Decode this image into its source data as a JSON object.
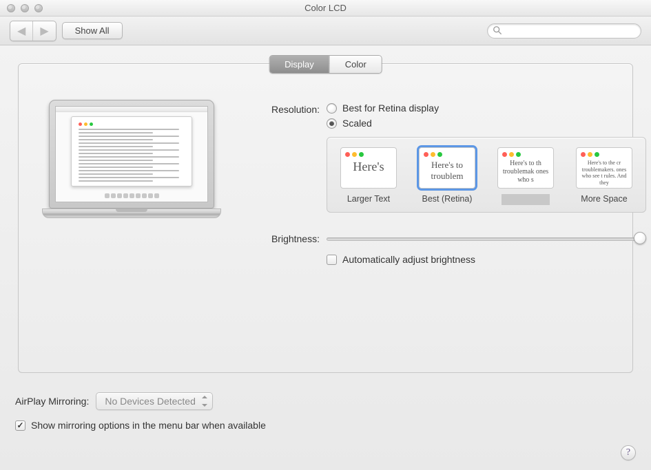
{
  "window": {
    "title": "Color LCD"
  },
  "toolbar": {
    "back_icon": "◀",
    "forward_icon": "▶",
    "show_all_label": "Show All",
    "search_placeholder": ""
  },
  "tabs": {
    "display": "Display",
    "color": "Color",
    "active": "display"
  },
  "resolution": {
    "label": "Resolution:",
    "option_best": "Best for Retina display",
    "option_scaled": "Scaled",
    "selected": "scaled",
    "scale_options": [
      {
        "thumb_text": "Here's",
        "label": "Larger Text",
        "selected": false
      },
      {
        "thumb_text": "Here's to troublem",
        "label": "Best (Retina)",
        "selected": true
      },
      {
        "thumb_text": "Here's to th troublemak ones who s",
        "label": "",
        "selected": false
      },
      {
        "thumb_text": "Here's to the cr troublemakers. ones who see t rules. And they",
        "label": "More Space",
        "selected": false
      }
    ]
  },
  "brightness": {
    "label": "Brightness:",
    "auto_label": "Automatically adjust brightness",
    "auto_checked": false,
    "value_percent": 100
  },
  "airplay": {
    "label": "AirPlay Mirroring:",
    "selected": "No Devices Detected"
  },
  "mirroring_checkbox": {
    "label": "Show mirroring options in the menu bar when available",
    "checked": true
  },
  "help_label": "?"
}
